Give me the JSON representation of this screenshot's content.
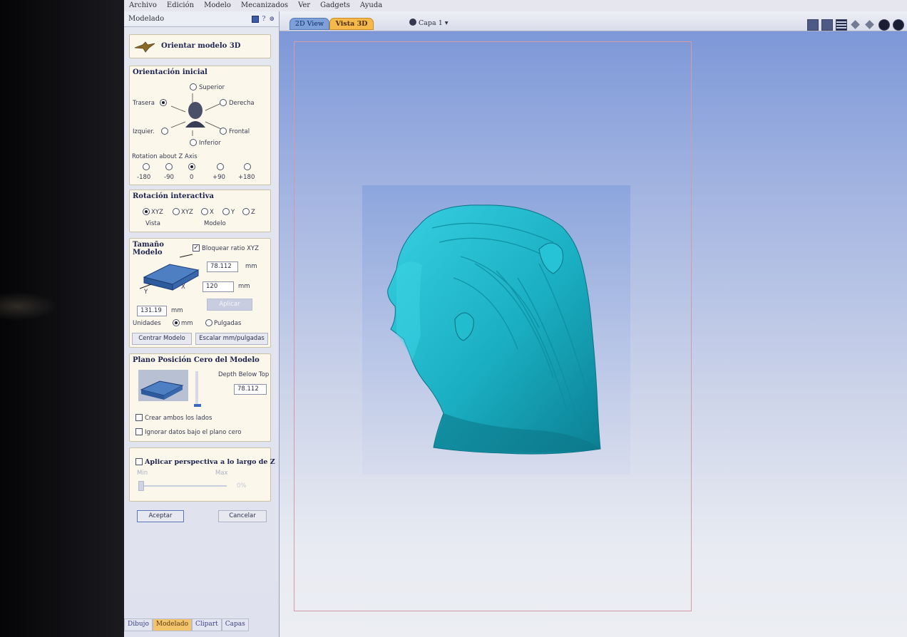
{
  "menu": [
    "Archivo",
    "Edición",
    "Modelo",
    "Mecanizados",
    "Ver",
    "Gadgets",
    "Ayuda"
  ],
  "panel": {
    "title": "Modelado",
    "orient_button": "Orientar modelo 3D",
    "initial": {
      "title": "Orientación inicial",
      "superior": "Superior",
      "trasera": "Trasera",
      "derecha": "Derecha",
      "izquierda": "Izquier.",
      "frontal": "Frontal",
      "inferior": "Inferior",
      "rot_label": "Rotation about Z Axis",
      "rot_values": [
        "-180",
        "-90",
        "0",
        "+90",
        "+180"
      ],
      "rot_selected": "0",
      "face_selected": "Trasera"
    },
    "interactive": {
      "title": "Rotación interactiva",
      "options": [
        "XYZ",
        "XYZ",
        "X",
        "Y",
        "Z"
      ],
      "selected": 0,
      "vista": "Vista",
      "modelo": "Modelo"
    },
    "size": {
      "title_1": "Tamaño",
      "title_2": "Modelo",
      "lock_label": "Bloquear ratio XYZ",
      "lock_checked": true,
      "z_value": "78.112",
      "y_value": "120",
      "x_value": "131.19",
      "unit_mm": "mm",
      "apply": "Aplicar",
      "axis_y": "Y",
      "axis_x": "X",
      "units_label": "Unidades",
      "units_mm": "mm",
      "units_in": "Pulgadas",
      "center_button": "Centrar Modelo",
      "scale_button": "Escalar mm/pulgadas"
    },
    "zero_plane": {
      "title": "Plano Posición Cero del Modelo",
      "depth_label": "Depth Below Top",
      "depth_value": "78.112",
      "both_sides": "Crear ambos los lados",
      "ignore_below": "Ignorar datos bajo el plano cero"
    },
    "perspective": {
      "label": "Aplicar perspectiva a lo largo de Z",
      "min": "Min",
      "max": "Max",
      "value": "0%"
    },
    "accept": "Aceptar",
    "cancel": "Cancelar",
    "bottom_tabs": [
      "Dibujo",
      "Modelado",
      "Clipart",
      "Capas"
    ],
    "bottom_active": "Modelado"
  },
  "view": {
    "tab_2d": "2D View",
    "tab_3d": "Vista 3D",
    "layer": "Capa 1 ▾",
    "model_color": "#1fb5c8"
  }
}
